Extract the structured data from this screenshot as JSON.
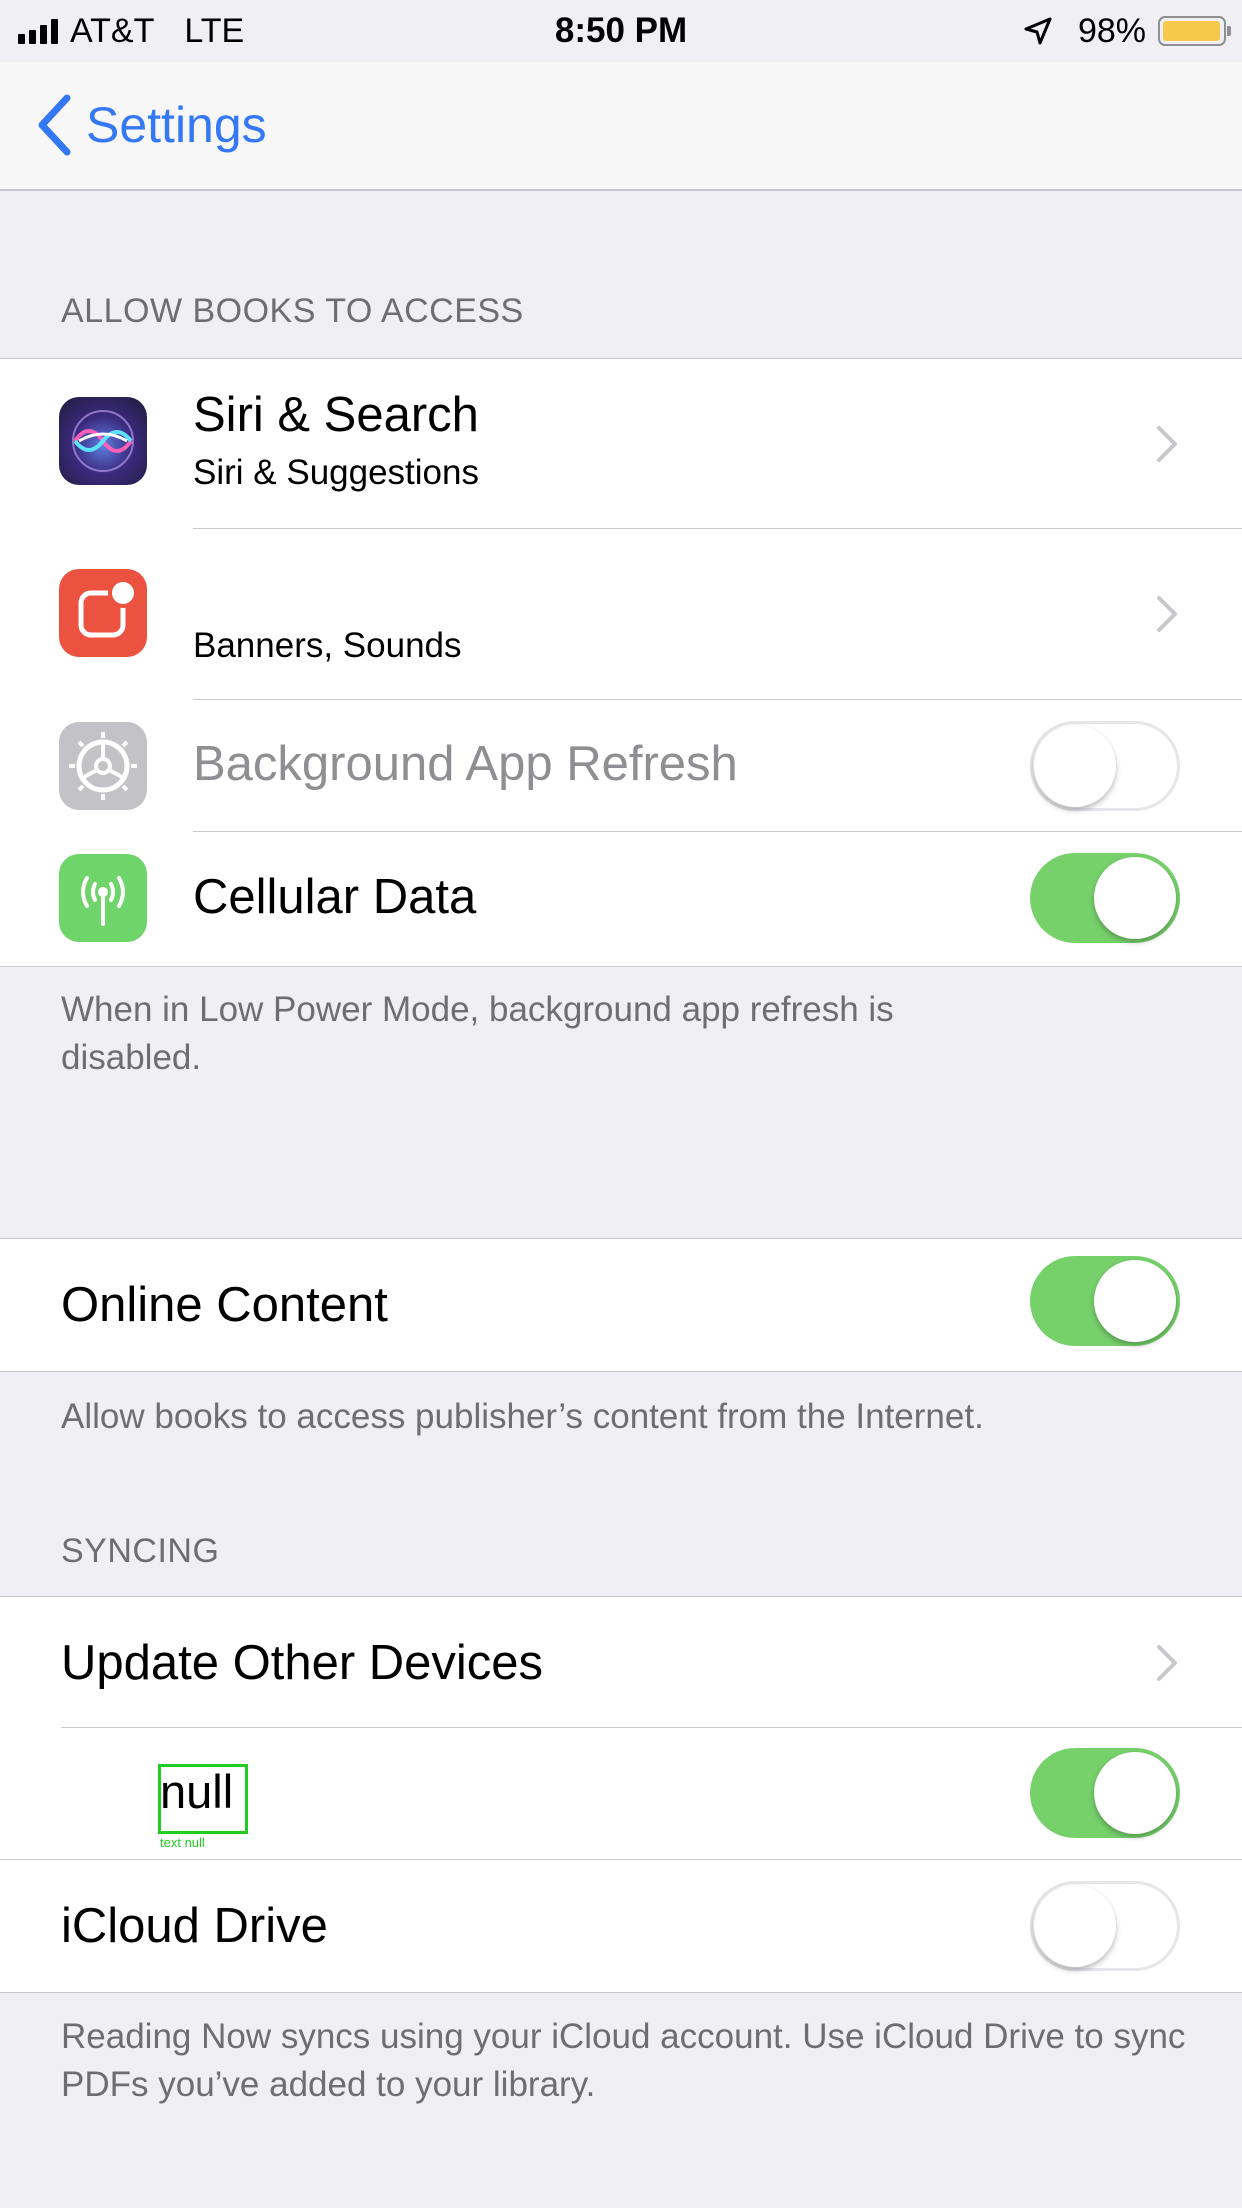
{
  "status_bar": {
    "carrier": "AT&T",
    "network": "LTE",
    "time": "8:50 PM",
    "battery": "98%",
    "battery_level": 0.98
  },
  "nav": {
    "back_label": "Settings"
  },
  "allow_section": {
    "header": "ALLOW BOOKS TO ACCESS",
    "siri": {
      "title": "Siri & Search",
      "subtitle": "Siri & Suggestions"
    },
    "notifications": {
      "subtitle": "Banners, Sounds"
    },
    "background_refresh": {
      "title": "Background App Refresh",
      "enabled": false
    },
    "cellular": {
      "title": "Cellular Data",
      "enabled": true
    },
    "footer": "When in Low Power Mode, background app refresh is disabled."
  },
  "online_content": {
    "title": "Online Content",
    "enabled": true,
    "footer": "Allow books to access publisher’s content from the Internet."
  },
  "syncing": {
    "header": "SYNCING",
    "update_devices": {
      "title": "Update Other Devices"
    },
    "null_row": {
      "title": "null",
      "debug_caption": "text null",
      "enabled": true
    },
    "icloud_drive": {
      "title": "iCloud Drive",
      "enabled": false
    },
    "footer": "Reading Now syncs using your iCloud account. Use iCloud Drive to sync PDFs you’ve added to your library."
  },
  "colors": {
    "accent": "#3478f6",
    "toggle_on": "#76d16b",
    "debug_box": "#22cc22"
  },
  "icons": [
    "signal-bars-icon",
    "location-arrow-icon",
    "battery-icon",
    "back-chevron-icon",
    "siri-icon",
    "notifications-icon",
    "settings-gear-icon",
    "cellular-antenna-icon",
    "chevron-right-icon"
  ]
}
